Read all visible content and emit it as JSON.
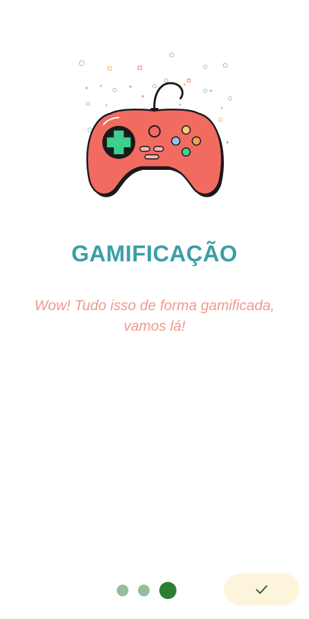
{
  "onboarding": {
    "title": "GAMIFICAÇÃO",
    "description": "Wow! Tudo isso de forma gamificada, vamos lá!",
    "illustration_icon": "gamepad-icon",
    "page_indicator": {
      "total_pages": 3,
      "current_page": 3
    },
    "done_button_icon": "check-icon"
  },
  "colors": {
    "title": "#3a9fa6",
    "description": "#ef9a8c",
    "dot_inactive": "#94bd9b",
    "dot_active": "#2e7d32",
    "button_bg": "#fdf4dc",
    "controller_body": "#f16b61",
    "dpad": "#3ecf8e"
  }
}
